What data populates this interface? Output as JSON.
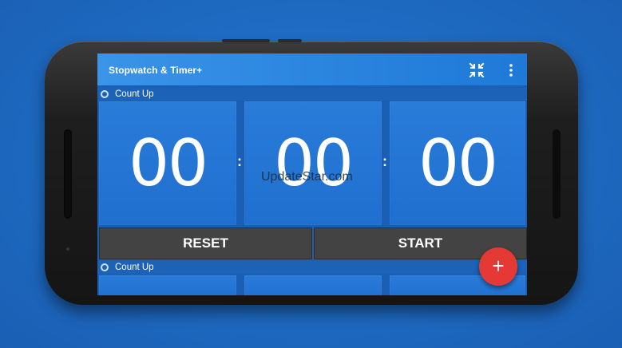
{
  "app": {
    "title": "Stopwatch & Timer+"
  },
  "toolbar": {
    "compress_icon": "compress-arrows-icon",
    "menu_icon": "more-vert-icon"
  },
  "timers": [
    {
      "mode_label": "Count Up",
      "hours": "00",
      "minutes": "00",
      "seconds": "00",
      "reset_label": "RESET",
      "start_label": "START"
    },
    {
      "mode_label": "Count Up"
    }
  ],
  "watermark": "UpdateStar.com",
  "fab": {
    "label": "+",
    "icon": "add-icon"
  },
  "colors": {
    "background": "#1f6cc4",
    "appbar": "#2b86e0",
    "timer_cell": "#2478d6",
    "button": "#434343",
    "fab": "#e53935"
  }
}
